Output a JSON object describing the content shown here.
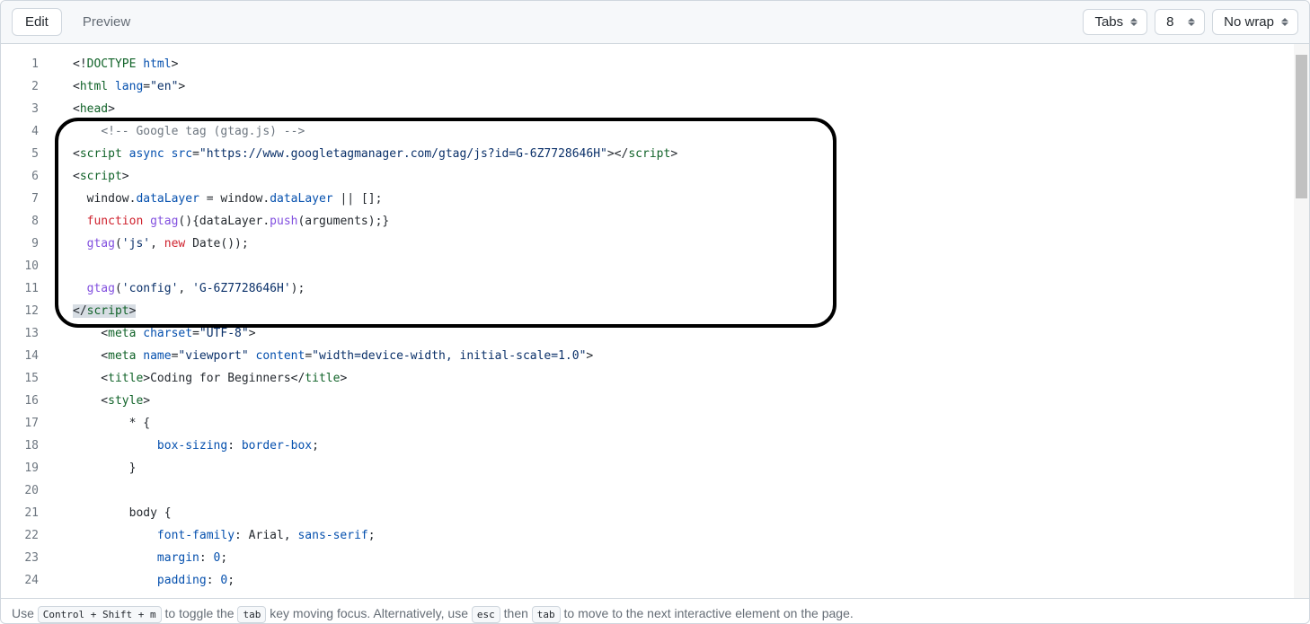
{
  "toolbar": {
    "edit_label": "Edit",
    "preview_label": "Preview",
    "indent_mode": "Tabs",
    "indent_size": "8",
    "wrap_mode": "No wrap"
  },
  "footer": {
    "part1": "Use ",
    "kbd1": "Control + Shift + m",
    "part2": " to toggle the ",
    "kbd2": "tab",
    "part3": " key moving focus. Alternatively, use ",
    "kbd3": "esc",
    "part4": " then ",
    "kbd4": "tab",
    "part5": " to move to the next interactive element on the page."
  },
  "code_lines": [
    [
      {
        "cls": "tok-plain",
        "t": "<!"
      },
      {
        "cls": "tok-tag",
        "t": "DOCTYPE"
      },
      {
        "cls": "tok-plain",
        "t": " "
      },
      {
        "cls": "tok-attr",
        "t": "html"
      },
      {
        "cls": "tok-plain",
        "t": ">"
      }
    ],
    [
      {
        "cls": "tok-plain",
        "t": "<"
      },
      {
        "cls": "tok-tag",
        "t": "html"
      },
      {
        "cls": "tok-plain",
        "t": " "
      },
      {
        "cls": "tok-attr",
        "t": "lang"
      },
      {
        "cls": "tok-plain",
        "t": "="
      },
      {
        "cls": "tok-str",
        "t": "\"en\""
      },
      {
        "cls": "tok-plain",
        "t": ">"
      }
    ],
    [
      {
        "cls": "tok-plain",
        "t": "<"
      },
      {
        "cls": "tok-tag",
        "t": "head"
      },
      {
        "cls": "tok-plain",
        "t": ">"
      }
    ],
    [
      {
        "cls": "tok-plain",
        "t": "    "
      },
      {
        "cls": "tok-comment",
        "t": "<!-- Google tag (gtag.js) -->"
      }
    ],
    [
      {
        "cls": "tok-plain",
        "t": "<"
      },
      {
        "cls": "tok-tag",
        "t": "script"
      },
      {
        "cls": "tok-plain",
        "t": " "
      },
      {
        "cls": "tok-attr",
        "t": "async"
      },
      {
        "cls": "tok-plain",
        "t": " "
      },
      {
        "cls": "tok-attr",
        "t": "src"
      },
      {
        "cls": "tok-plain",
        "t": "="
      },
      {
        "cls": "tok-str",
        "t": "\"https://www.googletagmanager.com/gtag/js?id=G-6Z7728646H\""
      },
      {
        "cls": "tok-plain",
        "t": "></"
      },
      {
        "cls": "tok-tag",
        "t": "script"
      },
      {
        "cls": "tok-plain",
        "t": ">"
      }
    ],
    [
      {
        "cls": "tok-plain",
        "t": "<"
      },
      {
        "cls": "tok-tag",
        "t": "script"
      },
      {
        "cls": "tok-plain",
        "t": ">"
      }
    ],
    [
      {
        "cls": "tok-plain",
        "t": "  window."
      },
      {
        "cls": "tok-attr",
        "t": "dataLayer"
      },
      {
        "cls": "tok-plain",
        "t": " = window."
      },
      {
        "cls": "tok-attr",
        "t": "dataLayer"
      },
      {
        "cls": "tok-plain",
        "t": " || [];"
      }
    ],
    [
      {
        "cls": "tok-plain",
        "t": "  "
      },
      {
        "cls": "tok-keyword",
        "t": "function"
      },
      {
        "cls": "tok-plain",
        "t": " "
      },
      {
        "cls": "tok-func",
        "t": "gtag"
      },
      {
        "cls": "tok-plain",
        "t": "(){dataLayer."
      },
      {
        "cls": "tok-func",
        "t": "push"
      },
      {
        "cls": "tok-plain",
        "t": "(arguments);}"
      }
    ],
    [
      {
        "cls": "tok-plain",
        "t": "  "
      },
      {
        "cls": "tok-func",
        "t": "gtag"
      },
      {
        "cls": "tok-plain",
        "t": "("
      },
      {
        "cls": "tok-str",
        "t": "'js'"
      },
      {
        "cls": "tok-plain",
        "t": ", "
      },
      {
        "cls": "tok-keyword",
        "t": "new"
      },
      {
        "cls": "tok-plain",
        "t": " Date());"
      }
    ],
    [
      {
        "cls": "tok-plain",
        "t": ""
      }
    ],
    [
      {
        "cls": "tok-plain",
        "t": "  "
      },
      {
        "cls": "tok-func",
        "t": "gtag"
      },
      {
        "cls": "tok-plain",
        "t": "("
      },
      {
        "cls": "tok-str",
        "t": "'config'"
      },
      {
        "cls": "tok-plain",
        "t": ", "
      },
      {
        "cls": "tok-str",
        "t": "'G-6Z7728646H'"
      },
      {
        "cls": "tok-plain",
        "t": ");"
      }
    ],
    [
      {
        "cls": "hl",
        "t": "</"
      },
      {
        "cls": "tok-tag hl",
        "t": "script"
      },
      {
        "cls": "hl",
        "t": ">"
      }
    ],
    [
      {
        "cls": "tok-plain",
        "t": "    <"
      },
      {
        "cls": "tok-tag",
        "t": "meta"
      },
      {
        "cls": "tok-plain",
        "t": " "
      },
      {
        "cls": "tok-attr",
        "t": "charset"
      },
      {
        "cls": "tok-plain",
        "t": "="
      },
      {
        "cls": "tok-str",
        "t": "\"UTF-8\""
      },
      {
        "cls": "tok-plain",
        "t": ">"
      }
    ],
    [
      {
        "cls": "tok-plain",
        "t": "    <"
      },
      {
        "cls": "tok-tag",
        "t": "meta"
      },
      {
        "cls": "tok-plain",
        "t": " "
      },
      {
        "cls": "tok-attr",
        "t": "name"
      },
      {
        "cls": "tok-plain",
        "t": "="
      },
      {
        "cls": "tok-str",
        "t": "\"viewport\""
      },
      {
        "cls": "tok-plain",
        "t": " "
      },
      {
        "cls": "tok-attr",
        "t": "content"
      },
      {
        "cls": "tok-plain",
        "t": "="
      },
      {
        "cls": "tok-str",
        "t": "\"width=device-width, initial-scale=1.0\""
      },
      {
        "cls": "tok-plain",
        "t": ">"
      }
    ],
    [
      {
        "cls": "tok-plain",
        "t": "    <"
      },
      {
        "cls": "tok-tag",
        "t": "title"
      },
      {
        "cls": "tok-plain",
        "t": ">Coding for Beginners</"
      },
      {
        "cls": "tok-tag",
        "t": "title"
      },
      {
        "cls": "tok-plain",
        "t": ">"
      }
    ],
    [
      {
        "cls": "tok-plain",
        "t": "    <"
      },
      {
        "cls": "tok-tag",
        "t": "style"
      },
      {
        "cls": "tok-plain",
        "t": ">"
      }
    ],
    [
      {
        "cls": "tok-plain",
        "t": "        * {"
      }
    ],
    [
      {
        "cls": "tok-plain",
        "t": "            "
      },
      {
        "cls": "tok-prop",
        "t": "box-sizing"
      },
      {
        "cls": "tok-plain",
        "t": ": "
      },
      {
        "cls": "tok-val",
        "t": "border-box"
      },
      {
        "cls": "tok-plain",
        "t": ";"
      }
    ],
    [
      {
        "cls": "tok-plain",
        "t": "        }"
      }
    ],
    [
      {
        "cls": "tok-plain",
        "t": ""
      }
    ],
    [
      {
        "cls": "tok-plain",
        "t": "        "
      },
      {
        "cls": "tok-sel",
        "t": "body"
      },
      {
        "cls": "tok-plain",
        "t": " {"
      }
    ],
    [
      {
        "cls": "tok-plain",
        "t": "            "
      },
      {
        "cls": "tok-prop",
        "t": "font-family"
      },
      {
        "cls": "tok-plain",
        "t": ": Arial, "
      },
      {
        "cls": "tok-val",
        "t": "sans-serif"
      },
      {
        "cls": "tok-plain",
        "t": ";"
      }
    ],
    [
      {
        "cls": "tok-plain",
        "t": "            "
      },
      {
        "cls": "tok-prop",
        "t": "margin"
      },
      {
        "cls": "tok-plain",
        "t": ": "
      },
      {
        "cls": "tok-val",
        "t": "0"
      },
      {
        "cls": "tok-plain",
        "t": ";"
      }
    ],
    [
      {
        "cls": "tok-plain",
        "t": "            "
      },
      {
        "cls": "tok-prop",
        "t": "padding"
      },
      {
        "cls": "tok-plain",
        "t": ": "
      },
      {
        "cls": "tok-val",
        "t": "0"
      },
      {
        "cls": "tok-plain",
        "t": ";"
      }
    ]
  ]
}
